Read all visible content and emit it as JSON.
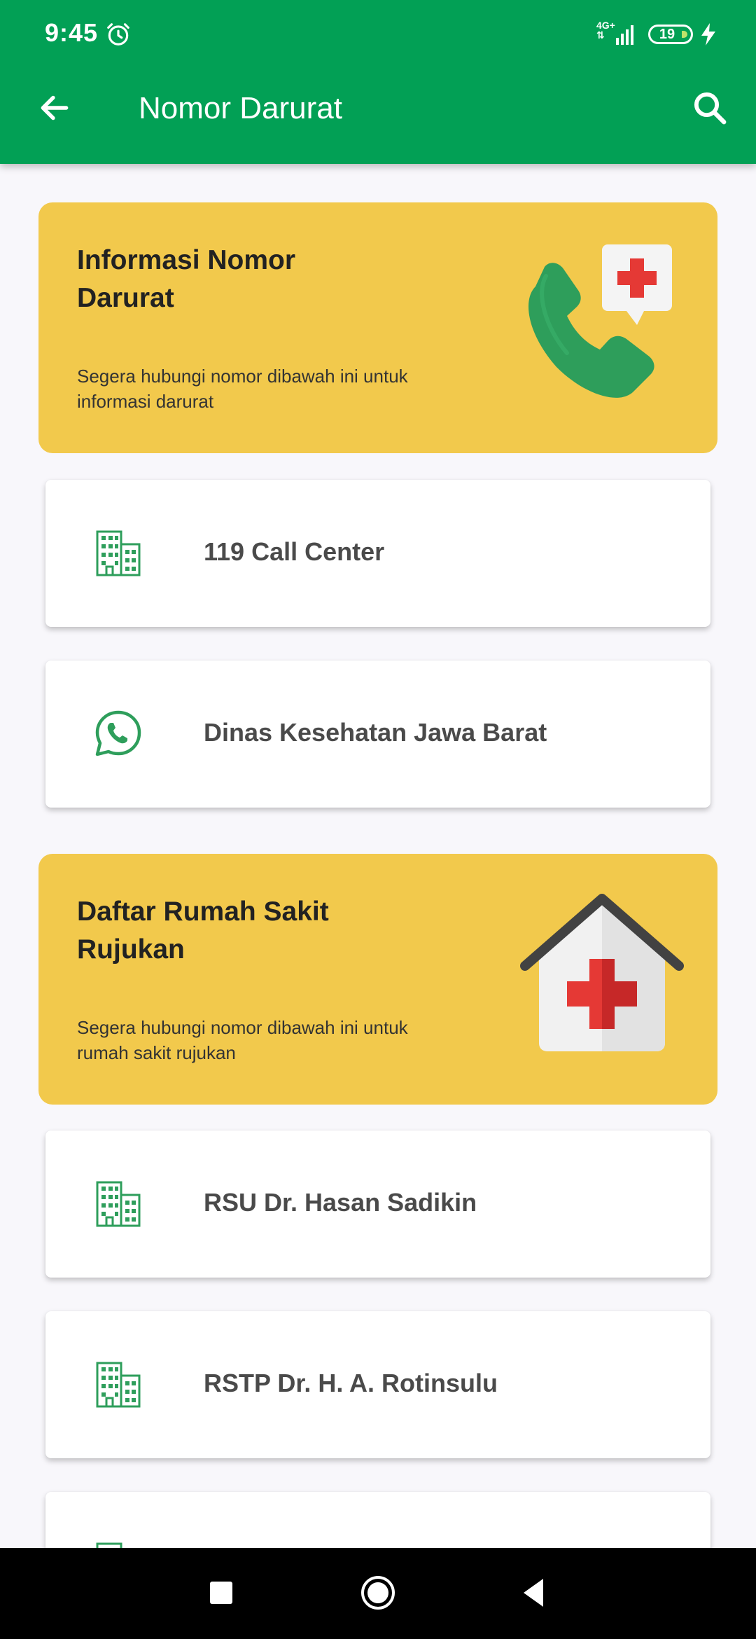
{
  "status_bar": {
    "time": "9:45",
    "network": "4G+",
    "battery": "19",
    "icons": [
      "alarm-icon",
      "signal-icon",
      "battery-icon",
      "charging-bolt-icon"
    ]
  },
  "app_bar": {
    "title": "Nomor Darurat",
    "back_icon": "arrow-left-icon",
    "search_icon": "search-icon",
    "background": "#02a055"
  },
  "sections": [
    {
      "title": "Informasi Nomor Darurat",
      "description": "Segera hubungi nomor dibawah ini untuk informasi darurat",
      "illustration": "phone-medical-icon",
      "items": [
        {
          "label": "119 Call Center",
          "icon": "building-icon"
        },
        {
          "label": "Dinas Kesehatan Jawa Barat",
          "icon": "whatsapp-icon"
        }
      ]
    },
    {
      "title": "Daftar Rumah Sakit Rujukan",
      "description": "Segera hubungi nomor dibawah ini untuk rumah sakit rujukan",
      "illustration": "hospital-house-icon",
      "items": [
        {
          "label": "RSU Dr. Hasan Sadikin",
          "icon": "building-icon"
        },
        {
          "label": "RSTP Dr. H. A. Rotinsulu",
          "icon": "building-icon"
        }
      ]
    }
  ],
  "colors": {
    "primary": "#02a055",
    "card_yellow": "#f2c94c",
    "icon_green": "#2e9e5b",
    "medical_red": "#e53935"
  }
}
